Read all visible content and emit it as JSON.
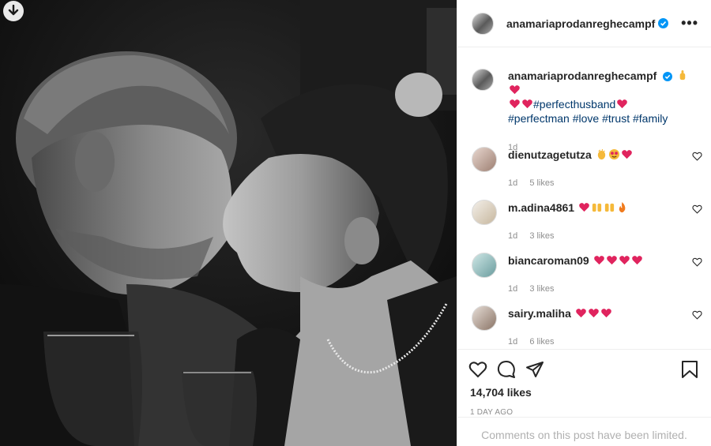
{
  "post": {
    "username": "anamariaprodanreghecampf",
    "more_label": "•••",
    "caption": {
      "username": "anamariaprodanreghecampf",
      "hashtags": [
        "#perfecthusband",
        "#perfectman",
        "#love",
        "#trust",
        "#family"
      ],
      "time": "1d"
    },
    "likes": "14,704 likes",
    "posted_ago": "1 DAY AGO",
    "comments_limited": "Comments on this post have been limited."
  },
  "comments": [
    {
      "username": "dienutzagetutza",
      "time": "1d",
      "likes": "5 likes",
      "emojis": [
        "clap",
        "star-eyes",
        "heart"
      ]
    },
    {
      "username": "m.adina4861",
      "time": "1d",
      "likes": "3 likes",
      "emojis": [
        "heart",
        "raised-hands",
        "raised-hands",
        "fire"
      ]
    },
    {
      "username": "biancaroman09",
      "time": "1d",
      "likes": "3 likes",
      "emojis": [
        "heart",
        "heart",
        "heart",
        "heart"
      ]
    },
    {
      "username": "sairy.maliha",
      "time": "1d",
      "likes": "6 likes",
      "emojis": [
        "heart",
        "heart",
        "heart"
      ]
    }
  ],
  "colors": {
    "hashtag": "#00376b",
    "verified": "#0095f6",
    "heart_emoji": "#e0245e",
    "meta_text": "#8e8e8e"
  },
  "icons": [
    "download-icon",
    "verified-badge-icon",
    "more-options-icon",
    "like-icon",
    "comment-icon",
    "share-icon",
    "save-icon"
  ]
}
